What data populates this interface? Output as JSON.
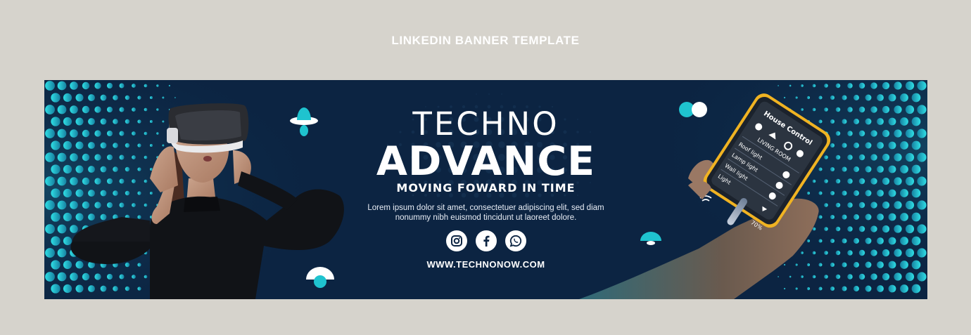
{
  "page": {
    "title": "LINKEDIN BANNER TEMPLATE"
  },
  "banner": {
    "headline_top": "TECHNO",
    "headline_main": "ADVANCE",
    "tagline": "MOVING FOWARD IN TIME",
    "body_line_1": "Lorem ipsum dolor sit amet, consectetuer adipiscing elit, sed diam",
    "body_line_2": "nonummy nibh euismod tincidunt ut laoreet dolore.",
    "website": "WWW.TECHNONOW.COM",
    "social_icons": [
      "instagram-icon",
      "facebook-icon",
      "whatsapp-icon"
    ],
    "phone_app": {
      "title": "House Control",
      "room": "LIVING ROOM",
      "items": [
        "Roof light",
        "Lamp light",
        "Wall light",
        "Light"
      ],
      "slider_value": "70%"
    }
  },
  "colors": {
    "background": "#d6d3cc",
    "banner": "#0c2442",
    "accent": "#1fc3cf",
    "text": "#ffffff"
  }
}
